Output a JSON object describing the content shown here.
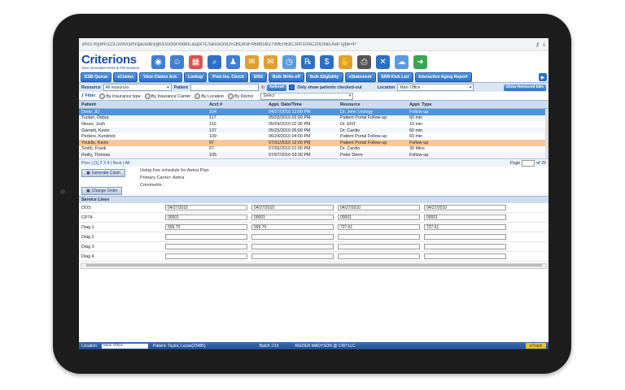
{
  "browser": {
    "url": "ehr2.myehr123.com/cehrqausdesign/Doctor/index.aspx?CSessionID=2BD43FA6881B2798E063C30010AC20D9&UserType=P",
    "icons": [
      "key-icon",
      "download-icon"
    ]
  },
  "app": {
    "brand": "Criterions",
    "tagline": "Your Innovative EHR & PM Solution"
  },
  "toolbar_icons": [
    "globe-icon",
    "user-icon",
    "calendar-icon",
    "search-icon",
    "person-icon",
    "mail-icon",
    "envelope-icon",
    "clock-icon",
    "rx-icon",
    "dollar-icon",
    "hand-icon",
    "printer-icon",
    "tools-icon",
    "network-icon",
    "exit-icon"
  ],
  "nav": {
    "tabs": [
      "ESB Queue",
      "eClaims",
      "View Claims Ack.",
      "Lookup",
      "Post Ins. Check",
      "ERN",
      "Bulk Write-off",
      "Bulk Eligibility",
      "eStatement",
      "ERN Kick List",
      "Interactive Aging Report"
    ],
    "next_arrow": "▶"
  },
  "filter": {
    "resource_label": "Resource",
    "resource_value": "All resources",
    "patient_label": "Patient",
    "refresh_label": "Refresh",
    "checked_out_label": "Only show patients checked-out",
    "location_label": "Location",
    "location_value": "Main Office",
    "show_removed_label": "Show Removed EBs",
    "filter_label": "Filter",
    "radios": [
      "By Insurance type",
      "By Insurance Carrier",
      "By Location",
      "By Doctor"
    ],
    "select_placeholder": "Select"
  },
  "grid": {
    "headers": [
      "Patient",
      "Acct #",
      "Appt. Date/Time",
      "Resource",
      "Appt. Type"
    ],
    "rows": [
      [
        "Drew, JD",
        "104",
        "04/27/2010 12:00 PM",
        "Dr. John Urology",
        "Follow-up"
      ],
      [
        "Tucker, Debra",
        "117",
        "05/03/2010 02:00 PM",
        "Patient Portal Follow-up",
        "60 min"
      ],
      [
        "Neuro, Josh",
        "110",
        "05/04/2010 02:30 PM",
        "Dr. ENT",
        "10 min"
      ],
      [
        "Garnett, Kevin",
        "137",
        "05/25/2010 05:00 PM",
        "Dr. Cardio",
        "60 min"
      ],
      [
        "Perkins, Kendrick",
        "139",
        "06/24/2010 04:00 PM",
        "Patient Portal Follow-up",
        "60 min"
      ],
      [
        "Youklis, Kevin",
        "97",
        "07/01/2010 12:00 PM",
        "Patient Portal Follow-up",
        "Follow-up"
      ],
      [
        "Smith, Frank",
        "67",
        "07/06/2010 01:00 PM",
        "Dr. Cardio",
        "30 Mins"
      ],
      [
        "Reilly, Thomas",
        "105",
        "07/07/2010 03:30 PM",
        "Peter Derm",
        "Follow-up"
      ]
    ]
  },
  "pager": {
    "left": "Prev | [1] 2 3 4 | Next | All",
    "page_label": "Page",
    "of_label": "of 29"
  },
  "claim": {
    "generate_label": "Generate Claim",
    "change_label": "Change Order",
    "fee_line": "Using Fee schedule for Aetna Plan",
    "carrier_line": "Primary Carrier: Aetna",
    "comments_line": "Comments :"
  },
  "service_lines": {
    "title": "Service Lines",
    "rows": [
      {
        "label": "DOS",
        "cells": [
          "04/27/2010",
          "04/27/2010",
          "04/27/2010",
          "04/27/2010"
        ]
      },
      {
        "label": "CPT4",
        "cells": [
          "00001",
          "00001",
          "00001",
          "00001"
        ]
      },
      {
        "label": "Diag 1",
        "cells": [
          "599.70",
          "599.70",
          "727.61",
          "727.61"
        ]
      },
      {
        "label": "Diag 2",
        "cells": [
          "",
          "",
          "",
          ""
        ]
      },
      {
        "label": "Diag 3",
        "cells": [
          "",
          "",
          "",
          ""
        ]
      },
      {
        "label": "Diag 4",
        "cells": [
          "",
          "",
          "",
          ""
        ]
      }
    ]
  },
  "footer": {
    "location_label": "Location",
    "location_value": "Main Office",
    "patient_text": "Patient:  Taylor, Lucas(23485)",
    "batch_text": "Batch  :215",
    "user_text": "RIEDER MADYSON @ CRITLLC",
    "etrack_label": "eTrack"
  },
  "colors": {
    "nav_blue": "#2d6fc4",
    "selected_row": "#4d94dd",
    "highlight_row": "#f6c79a",
    "footer": "#22508f"
  }
}
